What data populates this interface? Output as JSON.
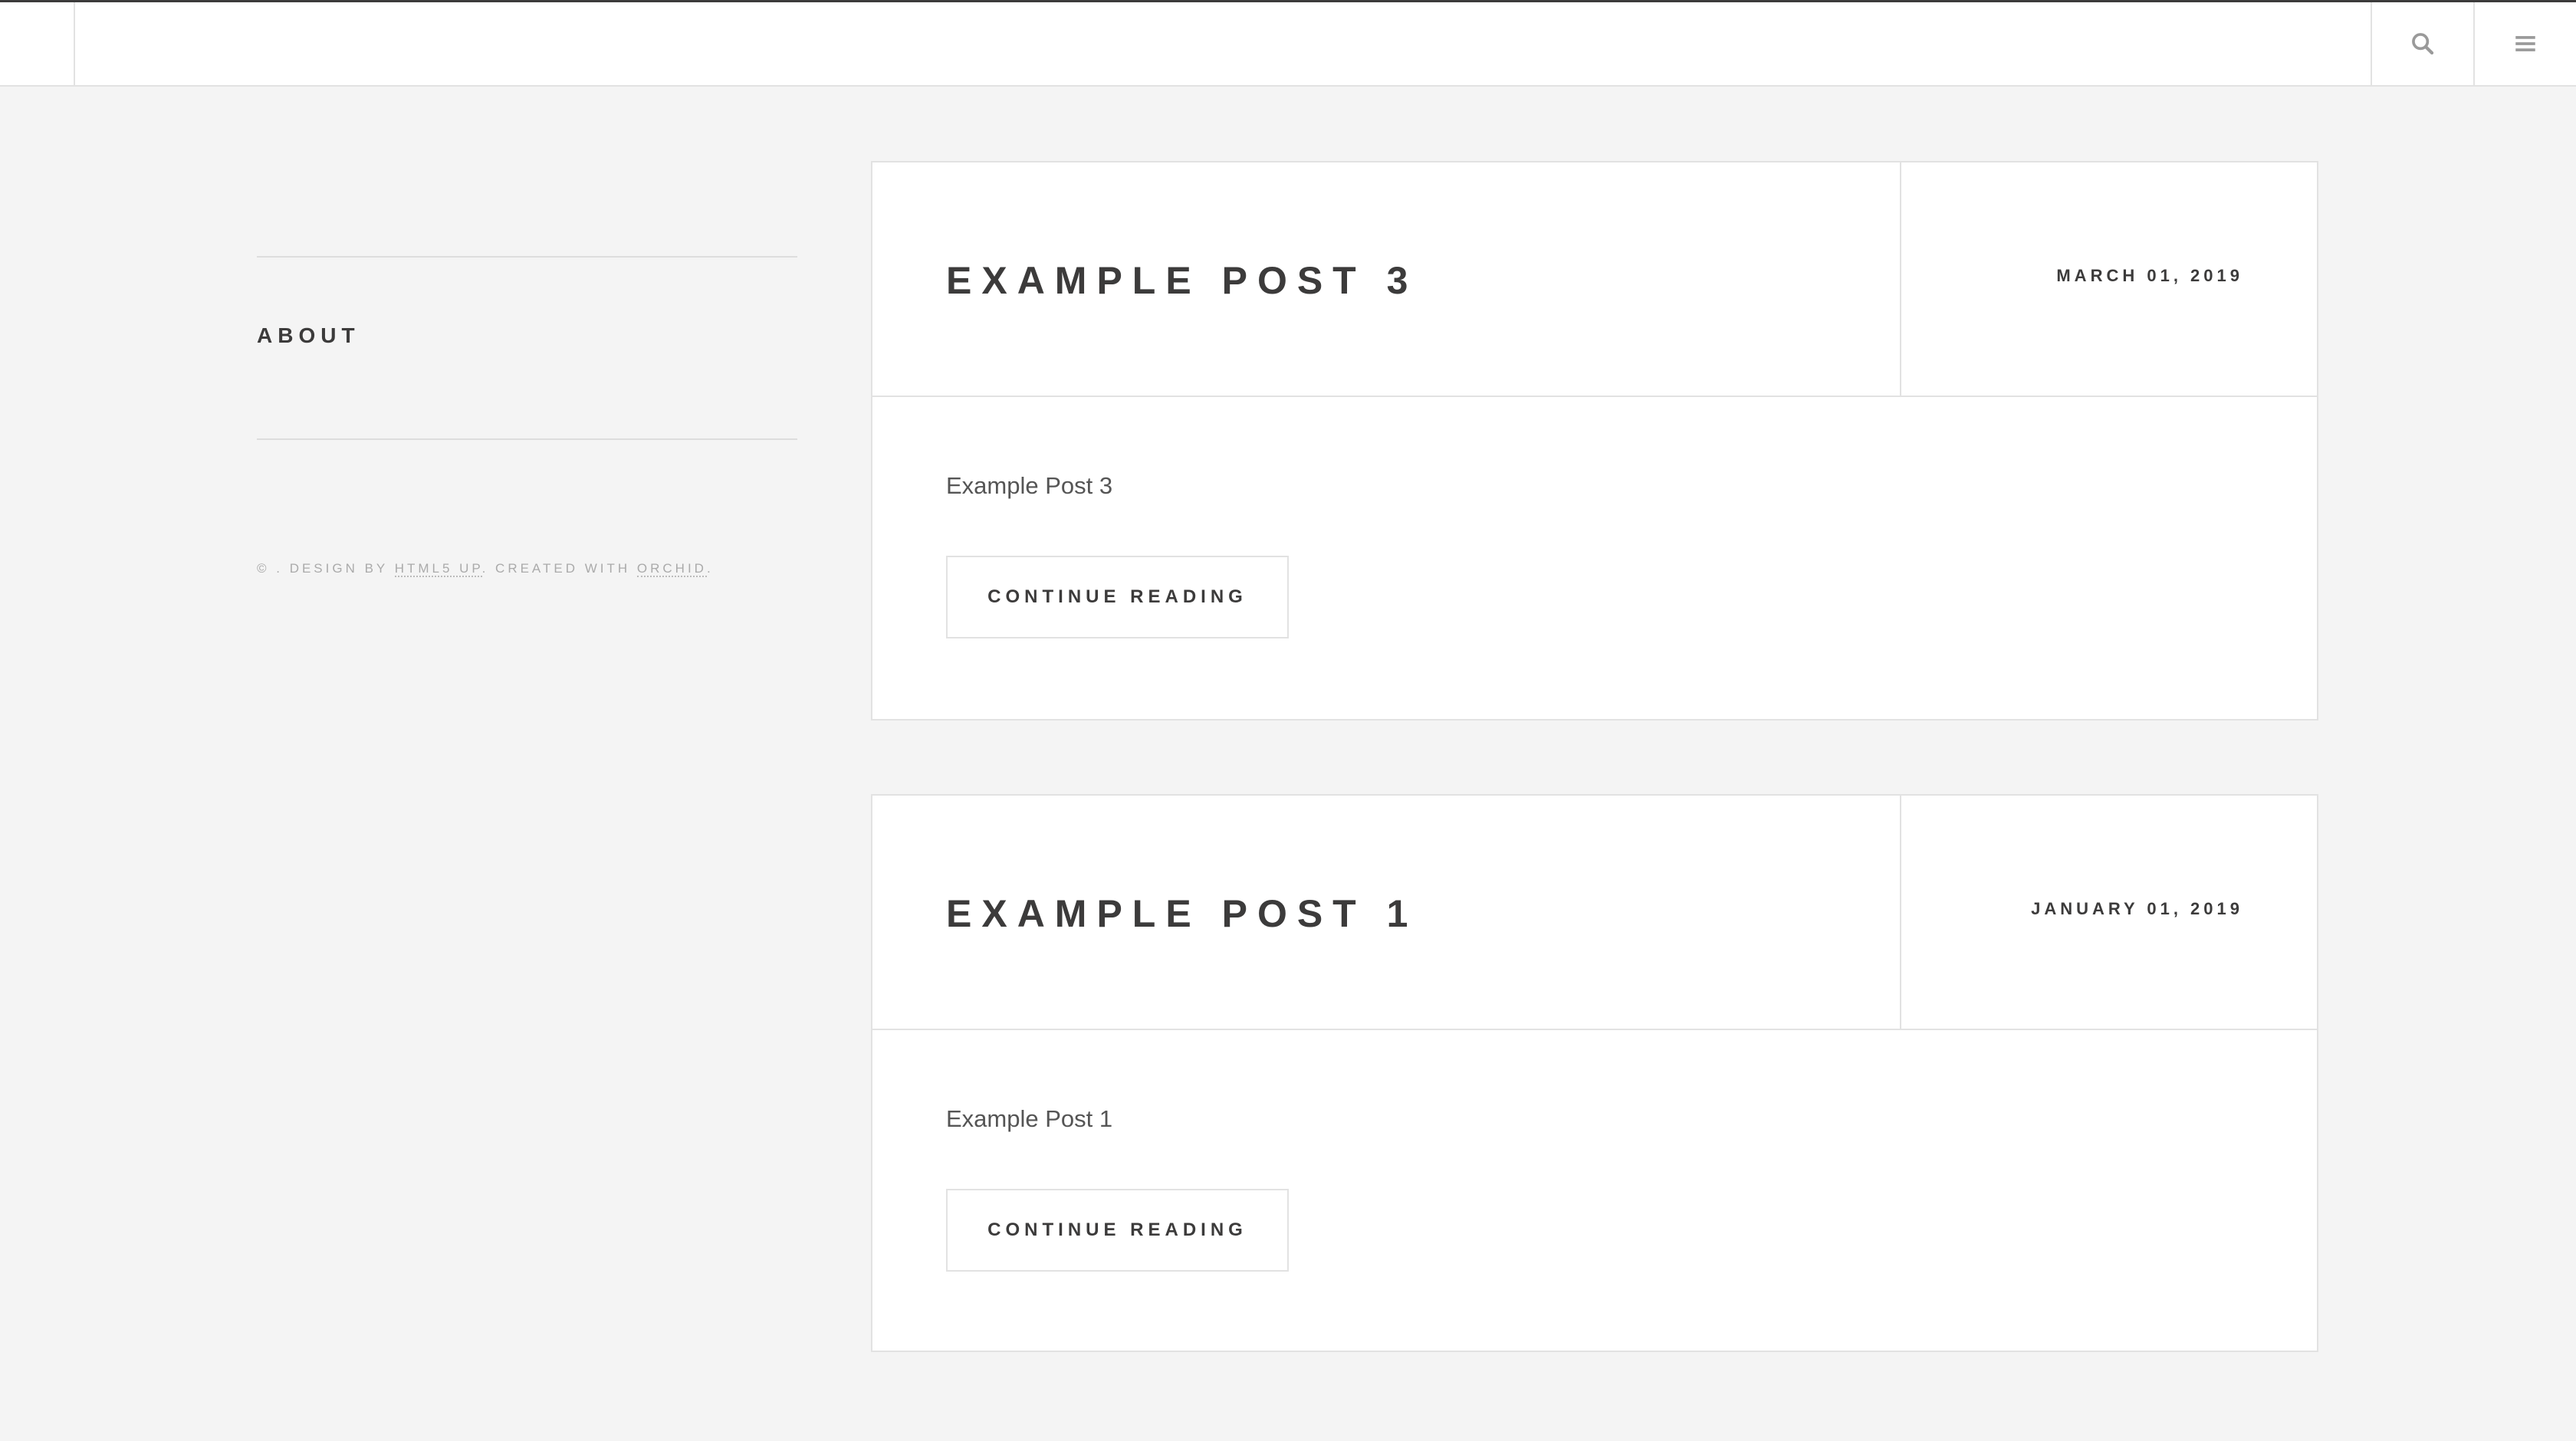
{
  "header": {
    "search_icon": "search-icon",
    "menu_icon": "hamburger-menu-icon"
  },
  "sidebar": {
    "about_label": "About",
    "copyright_prefix": "© . Design by ",
    "design_link": "HTML5 UP",
    "created_with": ". Created with ",
    "orchid_link": "Orchid",
    "suffix": "."
  },
  "posts": [
    {
      "title": "Example Post 3",
      "date": "March 01, 2019",
      "excerpt": "Example Post 3",
      "button_label": "Continue Reading"
    },
    {
      "title": "Example Post 1",
      "date": "January 01, 2019",
      "excerpt": "Example Post 1",
      "button_label": "Continue Reading"
    }
  ],
  "colors": {
    "background": "#f4f4f4",
    "surface": "#ffffff",
    "text": "#3c3b3b",
    "border": "#e2e2e2"
  }
}
